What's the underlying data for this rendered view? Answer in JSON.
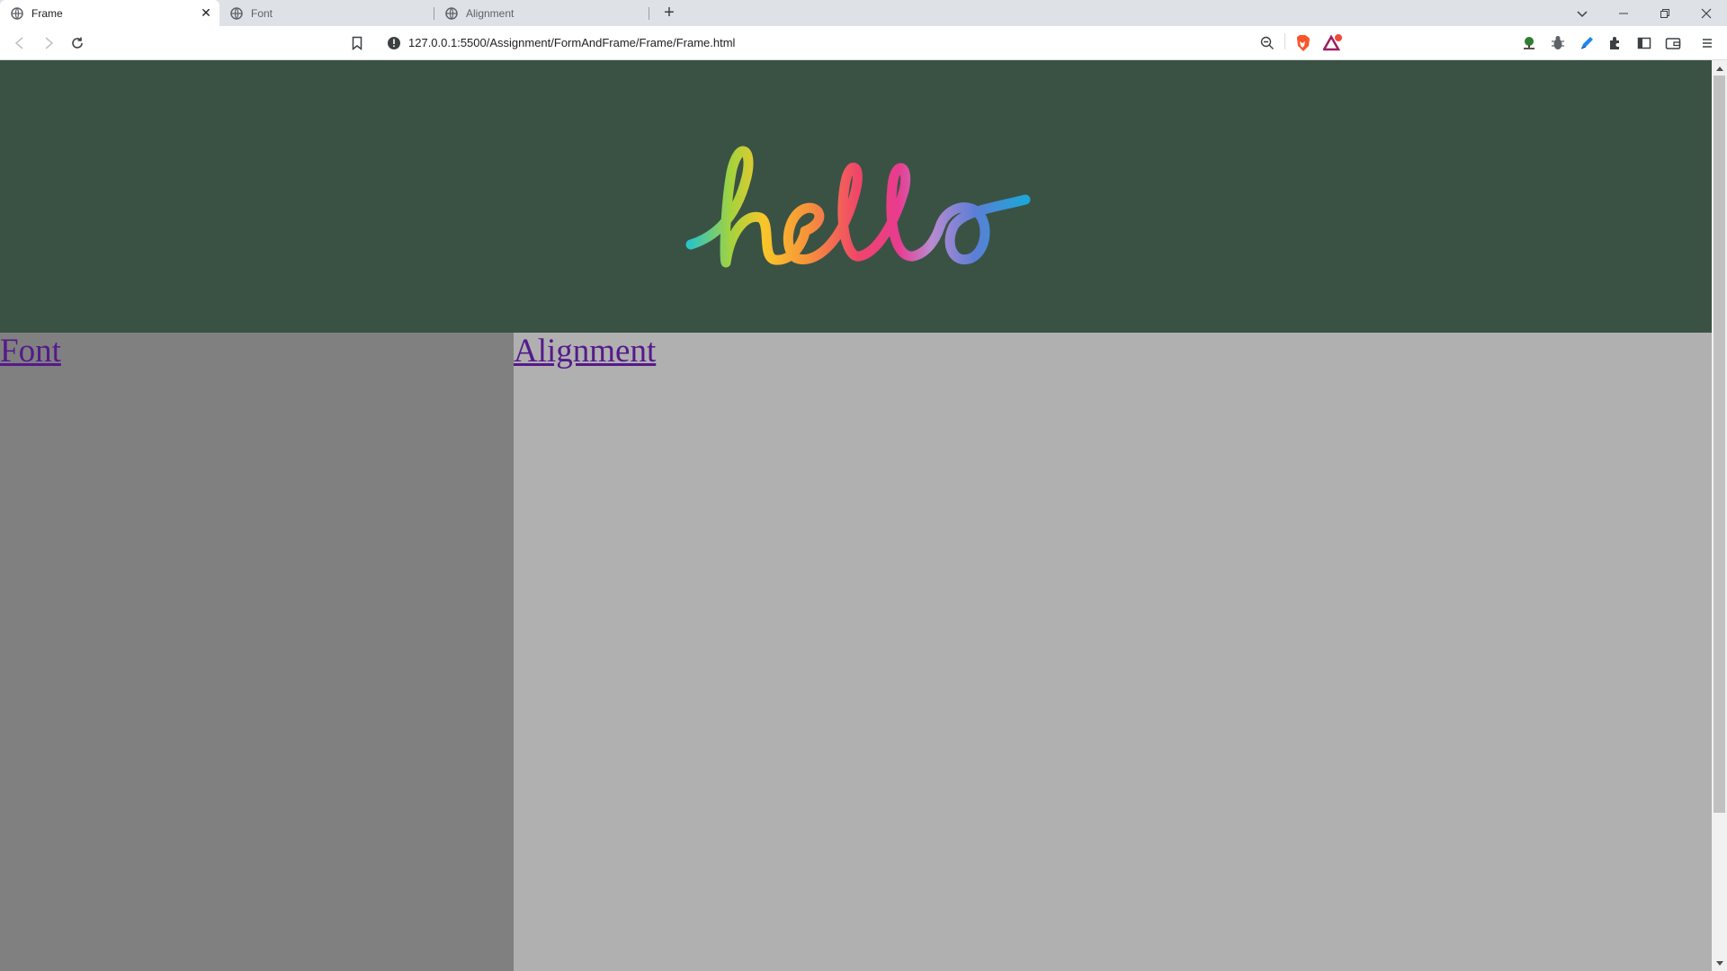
{
  "tabs": [
    {
      "title": "Frame",
      "active": true
    },
    {
      "title": "Font",
      "active": false
    },
    {
      "title": "Alignment",
      "active": false
    }
  ],
  "toolbar": {
    "url": "127.0.0.1:5500/Assignment/FormAndFrame/Frame/Frame.html"
  },
  "page": {
    "hero_text": "hello",
    "left_link": "Font",
    "right_link": "Alignment"
  },
  "colors": {
    "header_bg": "#3a5244",
    "left_bg": "#808080",
    "right_bg": "#b0b0b0",
    "link": "#551a8b"
  }
}
